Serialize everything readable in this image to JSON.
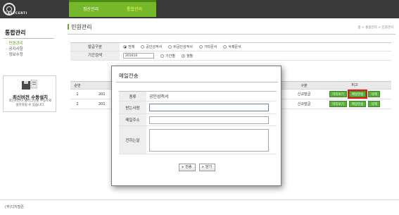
{
  "brand": {
    "logo_text": "EASYCERTI"
  },
  "topnav": {
    "items": [
      "정산관리",
      "통합관리"
    ]
  },
  "sidebar": {
    "title": "통합관리",
    "items": [
      "민원관리",
      "공지사항",
      "정보수정"
    ],
    "update_box": {
      "title": "최신버전 수동설치",
      "desc_line1": "최신버전이 플러그인을 수동으로",
      "desc_line2": "설치하실 수 있습니다."
    }
  },
  "main": {
    "title": "민원관리",
    "breadcrumb": "홈 > 통합관리 > 민원관리",
    "filter": {
      "kind_label": "발급구분",
      "kind_options": [
        "전체",
        "공인성적서",
        "비공인성적서",
        "기타문서",
        "삭제문서"
      ],
      "kind_selected": 0,
      "period_label": "기간검색",
      "period_value": "201610",
      "period_options": [
        "기간별",
        "월별"
      ],
      "period_selected": 1
    },
    "list": {
      "headers": {
        "no": "순번",
        "type": "구분",
        "etc": "비고"
      },
      "rows": [
        {
          "no": "1",
          "date": "201",
          "type": "신규발급"
        },
        {
          "no": "2",
          "date": "201",
          "type": "신규발급"
        }
      ],
      "buttons": {
        "view": "미리보기",
        "mail": "메일전송",
        "del": "삭제"
      }
    }
  },
  "modal": {
    "title": "메일전송",
    "rows": {
      "kind_label": "종류",
      "kind_value": "공인성적서",
      "recipient_label": "받는사람",
      "address_label": "메일주소",
      "message_label": "전하는말"
    },
    "send_label": "전송",
    "close_label": "닫기"
  },
  "footer": {
    "company": "(주)디지털존"
  },
  "colors": {
    "nav_green": "#75b82a",
    "button_green": "#5aae3a",
    "highlight_red": "#e21a1a"
  }
}
